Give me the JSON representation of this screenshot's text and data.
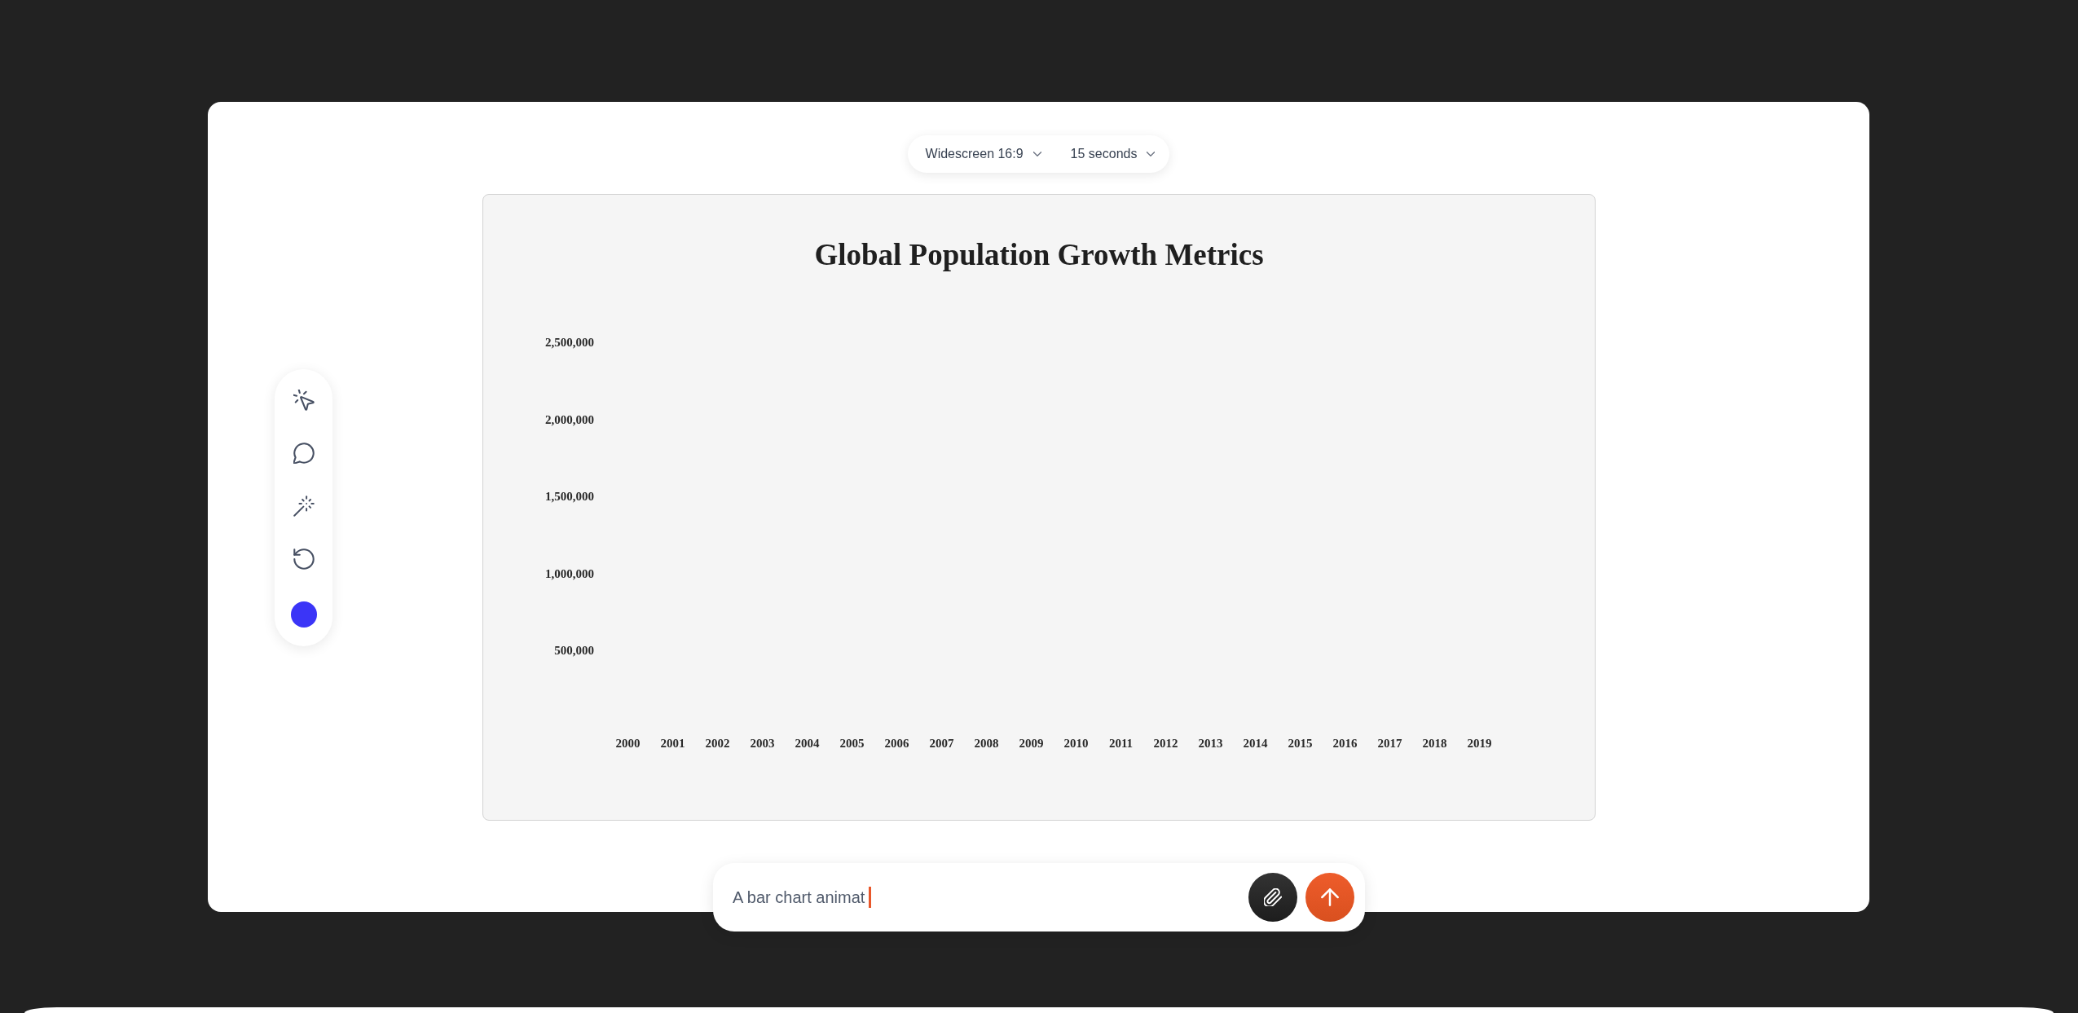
{
  "toolbar": {
    "dropdowns": [
      {
        "value": "Widescreen 16:9"
      },
      {
        "value": "15 seconds"
      }
    ]
  },
  "tool_rail": {
    "color": "#3b35f7"
  },
  "chart": {
    "chart_data": {
      "type": "bar",
      "title": "Global Population Growth Metrics",
      "categories": [
        "2000",
        "2001",
        "2002",
        "2003",
        "2004",
        "2005",
        "2006",
        "2007",
        "2008",
        "2009",
        "2010",
        "2011",
        "2012",
        "2013",
        "2014",
        "2015",
        "2016",
        "2017",
        "2018",
        "2019"
      ],
      "values": [
        null,
        null,
        null,
        null,
        null,
        null,
        null,
        null,
        null,
        null,
        null,
        null,
        null,
        null,
        null,
        null,
        null,
        null,
        null,
        null
      ],
      "ylim": [
        0,
        2500000
      ],
      "yticks": [
        {
          "value": 2500000,
          "label": "2,500,000"
        },
        {
          "value": 2000000,
          "label": "2,000,000"
        },
        {
          "value": 1500000,
          "label": "1,500,000"
        },
        {
          "value": 1000000,
          "label": "1,000,000"
        },
        {
          "value": 500000,
          "label": "500,000"
        }
      ]
    }
  },
  "prompt": {
    "value": "A bar chart animat",
    "focused": true
  }
}
